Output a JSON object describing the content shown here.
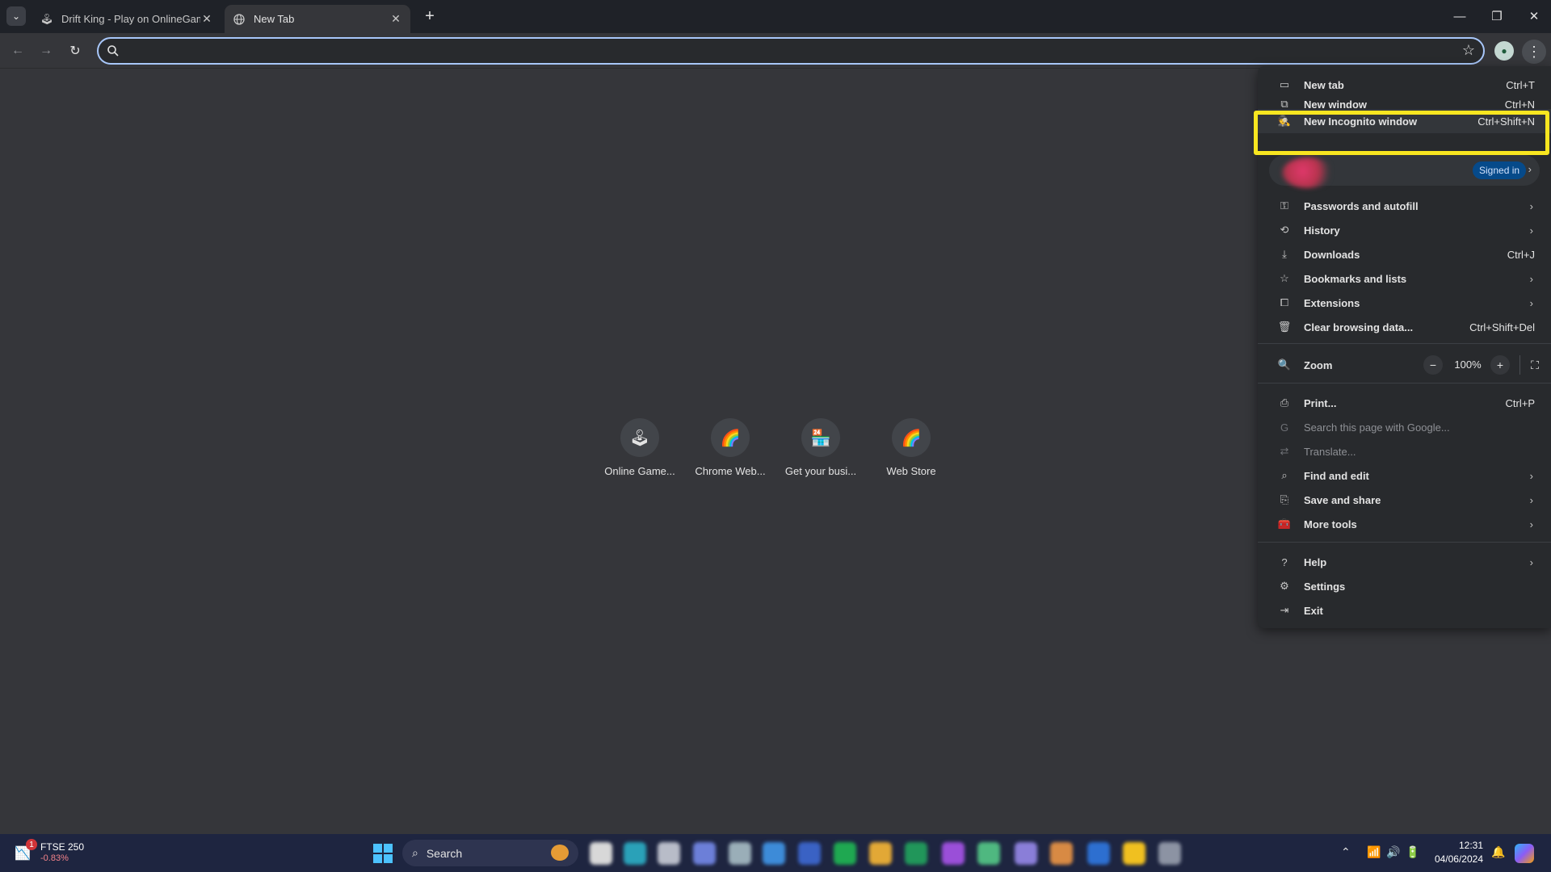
{
  "tabs": [
    {
      "title": "Drift King - Play on OnlineGam",
      "favicon": "joystick-icon",
      "active": false
    },
    {
      "title": "New Tab",
      "favicon": "globe-icon",
      "active": true
    }
  ],
  "omnibox": {
    "value": "",
    "placeholder": ""
  },
  "shortcuts": [
    {
      "label": "Online Game...",
      "icon": "joystick-icon"
    },
    {
      "label": "Chrome Web...",
      "icon": "rainbow-icon"
    },
    {
      "label": "Get your busi...",
      "icon": "storefront-icon"
    },
    {
      "label": "Web Store",
      "icon": "rainbow-icon"
    }
  ],
  "menu": {
    "new_tab": {
      "label": "New tab",
      "shortcut": "Ctrl+T"
    },
    "new_window": {
      "label": "New window",
      "shortcut": "Ctrl+N"
    },
    "incognito": {
      "label": "New Incognito window",
      "shortcut": "Ctrl+Shift+N"
    },
    "profile": {
      "status": "Signed in"
    },
    "passwords": {
      "label": "Passwords and autofill"
    },
    "history": {
      "label": "History"
    },
    "downloads": {
      "label": "Downloads",
      "shortcut": "Ctrl+J"
    },
    "bookmarks": {
      "label": "Bookmarks and lists"
    },
    "extensions": {
      "label": "Extensions"
    },
    "clear": {
      "label": "Clear browsing data...",
      "shortcut": "Ctrl+Shift+Del"
    },
    "zoom": {
      "label": "Zoom",
      "value": "100%",
      "minus": "−",
      "plus": "+"
    },
    "print": {
      "label": "Print...",
      "shortcut": "Ctrl+P"
    },
    "search_page": {
      "label": "Search this page with Google..."
    },
    "translate": {
      "label": "Translate..."
    },
    "find_edit": {
      "label": "Find and edit"
    },
    "save_share": {
      "label": "Save and share"
    },
    "more_tools": {
      "label": "More tools"
    },
    "help": {
      "label": "Help"
    },
    "settings": {
      "label": "Settings"
    },
    "exit": {
      "label": "Exit"
    }
  },
  "highlight_color": "#f8e620",
  "taskbar": {
    "stock": {
      "name": "FTSE 250",
      "change": "-0.83%",
      "badge": "1"
    },
    "search_label": "Search",
    "time": "12:31",
    "date": "04/06/2024"
  }
}
